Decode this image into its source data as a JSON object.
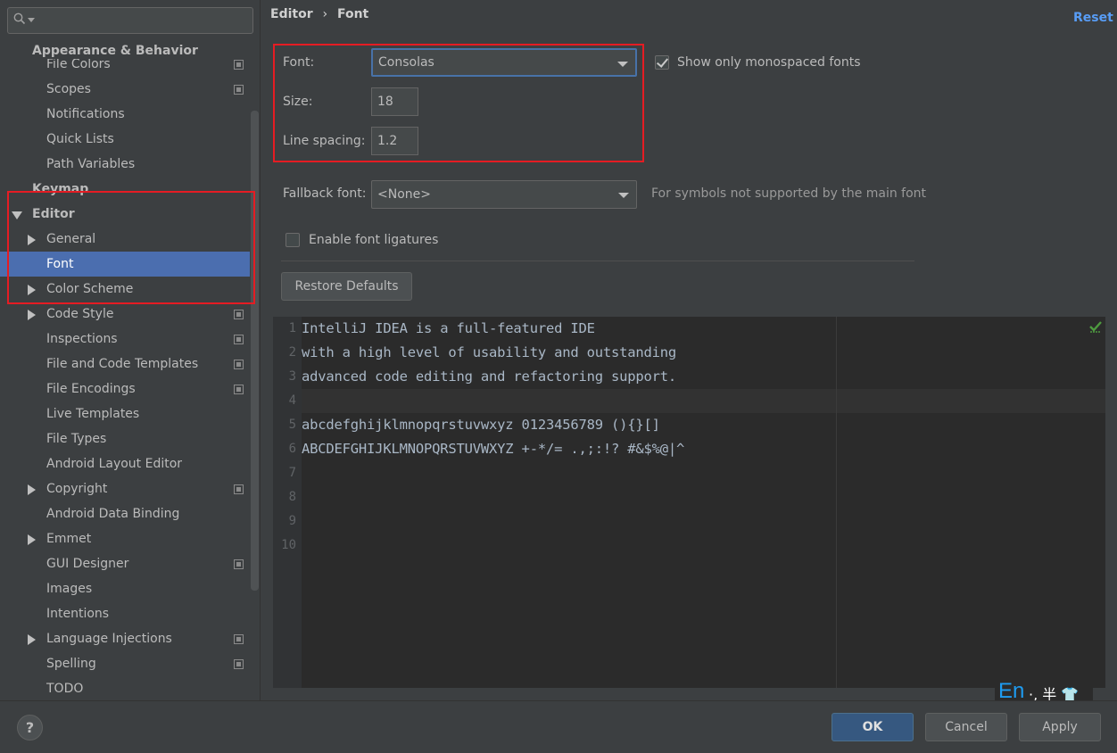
{
  "breadcrumb": [
    "Editor",
    "›",
    "Font"
  ],
  "reset_label": "Reset",
  "sidebar": {
    "search": {
      "placeholder": "",
      "value": ""
    },
    "items": [
      {
        "label": "Appearance & Behavior",
        "kind": "section"
      },
      {
        "label": "File Colors",
        "kind": "child",
        "copy": true
      },
      {
        "label": "Scopes",
        "kind": "child",
        "copy": true
      },
      {
        "label": "Notifications",
        "kind": "child"
      },
      {
        "label": "Quick Lists",
        "kind": "child"
      },
      {
        "label": "Path Variables",
        "kind": "child"
      },
      {
        "label": "Keymap",
        "kind": "section"
      },
      {
        "label": "Editor",
        "kind": "section",
        "expanded": true
      },
      {
        "label": "General",
        "kind": "child",
        "arrow": true
      },
      {
        "label": "Font",
        "kind": "child",
        "selected": true
      },
      {
        "label": "Color Scheme",
        "kind": "child",
        "arrow": true
      },
      {
        "label": "Code Style",
        "kind": "child",
        "arrow": true,
        "copy": true
      },
      {
        "label": "Inspections",
        "kind": "child",
        "copy": true
      },
      {
        "label": "File and Code Templates",
        "kind": "child",
        "copy": true
      },
      {
        "label": "File Encodings",
        "kind": "child",
        "copy": true
      },
      {
        "label": "Live Templates",
        "kind": "child"
      },
      {
        "label": "File Types",
        "kind": "child"
      },
      {
        "label": "Android Layout Editor",
        "kind": "child"
      },
      {
        "label": "Copyright",
        "kind": "child",
        "arrow": true,
        "copy": true
      },
      {
        "label": "Android Data Binding",
        "kind": "child"
      },
      {
        "label": "Emmet",
        "kind": "child",
        "arrow": true
      },
      {
        "label": "GUI Designer",
        "kind": "child",
        "copy": true
      },
      {
        "label": "Images",
        "kind": "child"
      },
      {
        "label": "Intentions",
        "kind": "child"
      },
      {
        "label": "Language Injections",
        "kind": "child",
        "arrow": true,
        "copy": true
      },
      {
        "label": "Spelling",
        "kind": "child",
        "copy": true
      },
      {
        "label": "TODO",
        "kind": "child"
      }
    ]
  },
  "font": {
    "font_label": "Font:",
    "font_value": "Consolas",
    "monospaced_label": "Show only monospaced fonts",
    "monospaced_checked": true,
    "size_label": "Size:",
    "size_value": "18",
    "spacing_label": "Line spacing:",
    "spacing_value": "1.2",
    "fallback_label": "Fallback font:",
    "fallback_value": "<None>",
    "fallback_hint": "For symbols not supported by the main font",
    "ligatures_label": "Enable font ligatures",
    "ligatures_checked": false,
    "restore_label": "Restore Defaults"
  },
  "preview": {
    "line_numbers": [
      "1",
      "2",
      "3",
      "4",
      "5",
      "6",
      "7",
      "8",
      "9",
      "10"
    ],
    "lines": [
      "IntelliJ IDEA is a full-featured IDE",
      "with a high level of usability and outstanding",
      "advanced code editing and refactoring support.",
      "",
      "abcdefghijklmnopqrstuvwxyz 0123456789 (){}[]",
      "ABCDEFGHIJKLMNOPQRSTUVWXYZ +-*/= .,;:!? #&$%@|^",
      "",
      "",
      "",
      ""
    ]
  },
  "ime": {
    "lang": "En",
    "rest": "·, 半 👕"
  },
  "footer": {
    "help": "?",
    "ok": "OK",
    "cancel": "Cancel",
    "apply": "Apply"
  },
  "colors": {
    "accent": "#4b6eaf",
    "link": "#589df6",
    "highlight": "#e51c23"
  }
}
